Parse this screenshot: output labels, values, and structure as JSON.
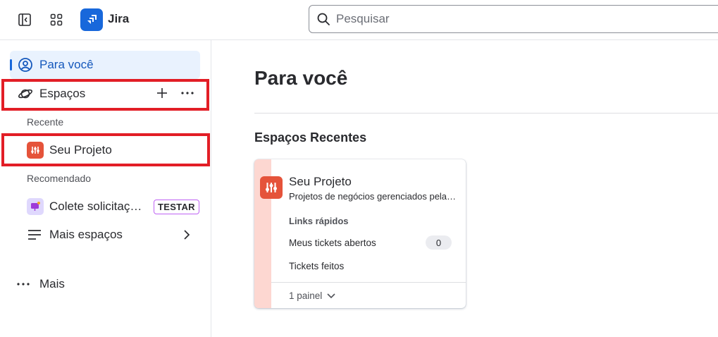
{
  "header": {
    "app_title": "Jira",
    "search_placeholder": "Pesquisar"
  },
  "sidebar": {
    "for_you": "Para você",
    "spaces": "Espaços",
    "recent_label": "Recente",
    "recent_project": "Seu Projeto",
    "recommended_label": "Recomendado",
    "recommended_item": "Colete solicitações",
    "recommended_badge": "TESTAR",
    "more_spaces": "Mais espaços",
    "more": "Mais"
  },
  "main": {
    "title": "Para você",
    "recent_spaces_title": "Espaços Recentes",
    "card": {
      "title": "Seu Projeto",
      "subtitle": "Projetos de negócios gerenciados pela equipe",
      "quick_links_label": "Links rápidos",
      "open_tickets": "Meus tickets abertos",
      "open_tickets_count": "0",
      "done_tickets": "Tickets feitos",
      "panel": "1 painel"
    }
  },
  "colors": {
    "accent": "#1868db",
    "active_bg": "#e9f2fe",
    "project_icon": "#e5533a",
    "card_stripe": "#fdd7d1",
    "highlight": "#e21e26",
    "badge_border": "#bf63f3"
  }
}
